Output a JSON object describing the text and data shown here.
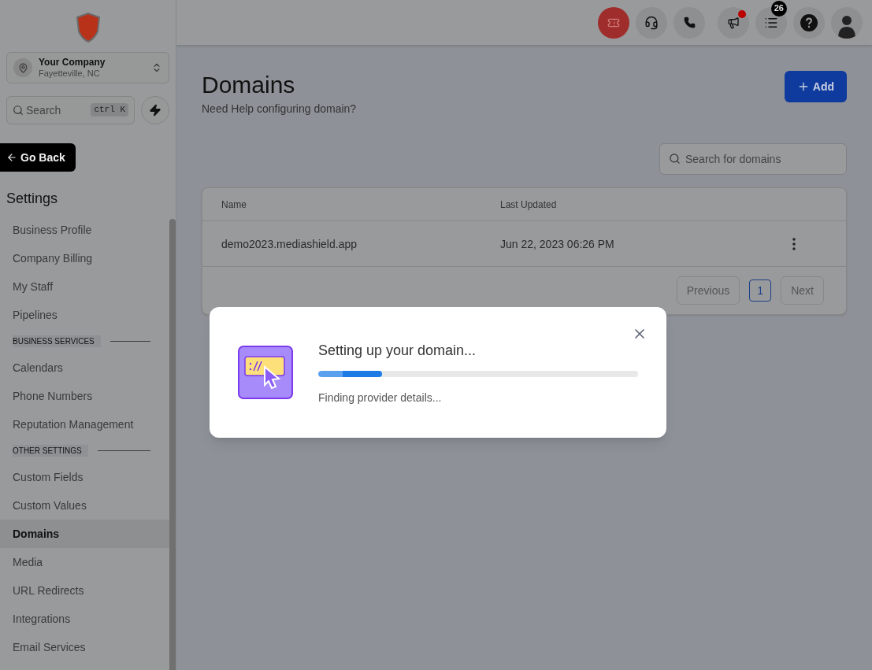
{
  "sidebar": {
    "account": {
      "name": "Your Company",
      "location": "Fayetteville, NC"
    },
    "search": {
      "placeholder": "Search",
      "shortcut": "ctrl K"
    },
    "back_button": "Go Back",
    "heading": "Settings",
    "items": [
      {
        "kind": "item",
        "label": "Business Profile",
        "selected": false
      },
      {
        "kind": "item",
        "label": "Company Billing",
        "selected": false
      },
      {
        "kind": "item",
        "label": "My Staff",
        "selected": false
      },
      {
        "kind": "item",
        "label": "Pipelines",
        "selected": false
      },
      {
        "kind": "section",
        "label": "BUSINESS SERVICES"
      },
      {
        "kind": "item",
        "label": "Calendars",
        "selected": false
      },
      {
        "kind": "item",
        "label": "Phone Numbers",
        "selected": false
      },
      {
        "kind": "item",
        "label": "Reputation Management",
        "selected": false
      },
      {
        "kind": "section",
        "label": "OTHER SETTINGS"
      },
      {
        "kind": "item",
        "label": "Custom Fields",
        "selected": false
      },
      {
        "kind": "item",
        "label": "Custom Values",
        "selected": false
      },
      {
        "kind": "item",
        "label": "Domains",
        "selected": true
      },
      {
        "kind": "item",
        "label": "Media",
        "selected": false
      },
      {
        "kind": "item",
        "label": "URL Redirects",
        "selected": false
      },
      {
        "kind": "item",
        "label": "Integrations",
        "selected": false
      },
      {
        "kind": "item",
        "label": "Email Services",
        "selected": false
      }
    ]
  },
  "topbar": {
    "notification_dot": true,
    "task_count": "26"
  },
  "page": {
    "title": "Domains",
    "help_link": "Need Help configuring domain?",
    "add_button": "Add",
    "search": {
      "placeholder": "Search for domains"
    },
    "table": {
      "columns": [
        "Name",
        "Last Updated"
      ],
      "rows": [
        {
          "name": "demo2023.mediashield.app",
          "updated": "Jun 22, 2023 06:26 PM"
        }
      ]
    },
    "pagination": {
      "previous": "Previous",
      "next": "Next",
      "pages": [
        {
          "label": "1",
          "selected": true
        }
      ]
    }
  },
  "modal": {
    "title": "Setting up your domain...",
    "level": 0.2,
    "status": "Finding provider details..."
  }
}
